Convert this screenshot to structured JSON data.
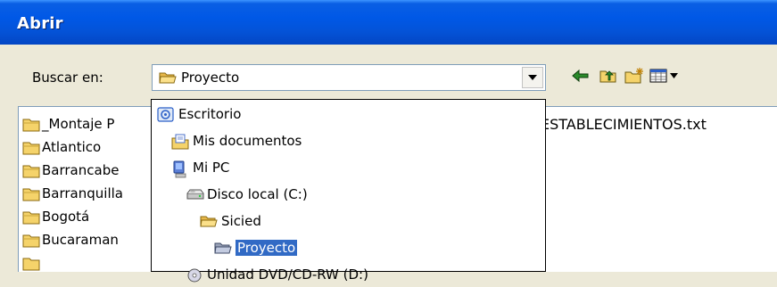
{
  "window": {
    "title": "Abrir"
  },
  "lookin": {
    "label": "Buscar en:",
    "value": "Proyecto"
  },
  "toolbar": [
    {
      "icon": "back-arrow-icon"
    },
    {
      "icon": "up-one-level-icon"
    },
    {
      "icon": "new-folder-icon"
    },
    {
      "icon": "view-menu-icon"
    }
  ],
  "files": [
    {
      "label": "_Montaje P",
      "icon": "folder-icon"
    },
    {
      "label": "Atlantico",
      "icon": "folder-icon"
    },
    {
      "label": "Barrancabe",
      "icon": "folder-icon"
    },
    {
      "label": "Barranquilla",
      "icon": "folder-icon"
    },
    {
      "label": "Bogotá",
      "icon": "folder-icon"
    },
    {
      "label": "Bucaraman",
      "icon": "folder-icon"
    }
  ],
  "file_text": "ESTABLECIMIENTOS.txt",
  "dropdown": [
    {
      "label": "Escritorio",
      "icon": "desktop-icon"
    },
    {
      "label": "Mis documentos",
      "icon": "my-documents-icon"
    },
    {
      "label": "Mi PC",
      "icon": "my-computer-icon"
    },
    {
      "label": "Disco local (C:)",
      "icon": "hard-drive-icon"
    },
    {
      "label": "Sicied",
      "icon": "open-folder-icon"
    },
    {
      "label": "Proyecto",
      "icon": "open-folder-icon",
      "selected": true
    },
    {
      "label": "Unidad DVD/CD-RW (D:)",
      "icon": "cd-drive-icon"
    }
  ],
  "colors": {
    "titlebar": "#0058e6",
    "dialog_bg": "#ece9d8",
    "selection": "#316ac5",
    "folder": "#f5d36a"
  }
}
